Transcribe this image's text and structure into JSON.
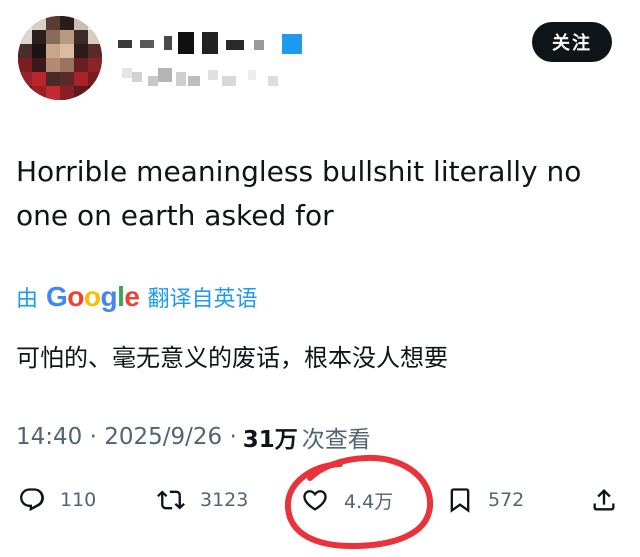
{
  "header": {
    "follow_label": "关注"
  },
  "tweet": {
    "text": "Horrible meaningless bullshit literally no one on earth asked for"
  },
  "translation": {
    "prefix": "由",
    "provider_logo": "Google",
    "suffix": "翻译自英语",
    "text": "可怕的、毫无意义的废话，根本没人想要"
  },
  "meta": {
    "timestamp": "14:40 · 2025/9/26 ·",
    "views_count": "31万",
    "views_label": "次查看"
  },
  "actions": {
    "reply": {
      "icon": "reply-icon",
      "count": "110"
    },
    "retweet": {
      "icon": "retweet-icon",
      "count": "3123"
    },
    "like": {
      "icon": "heart-icon",
      "count": "4.4万"
    },
    "bookmark": {
      "icon": "bookmark-icon",
      "count": "572"
    },
    "share": {
      "icon": "share-icon"
    }
  },
  "colors": {
    "link": "#1d9bf0",
    "text": "#0f1419",
    "secondary": "#536471",
    "annotation": "#e8333a",
    "google_blue": "#4285F4",
    "google_red": "#EA4335",
    "google_yellow": "#FBBC05",
    "google_green": "#34A853"
  }
}
